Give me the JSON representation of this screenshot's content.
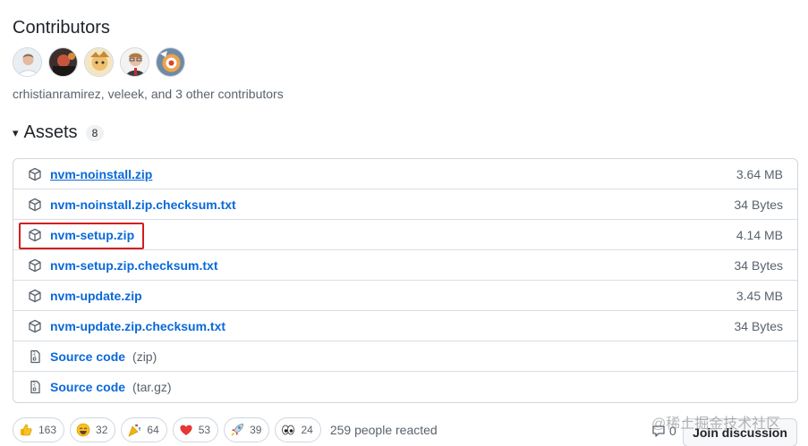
{
  "contributors": {
    "title": "Contributors",
    "summary": "crhistianramirez, veleek, and 3 other contributors"
  },
  "assets": {
    "caret": "▾",
    "title": "Assets",
    "count": "8",
    "items": [
      {
        "name": "nvm-noinstall.zip",
        "size": "3.64 MB"
      },
      {
        "name": "nvm-noinstall.zip.checksum.txt",
        "size": "34 Bytes"
      },
      {
        "name": "nvm-setup.zip",
        "size": "4.14 MB"
      },
      {
        "name": "nvm-setup.zip.checksum.txt",
        "size": "34 Bytes"
      },
      {
        "name": "nvm-update.zip",
        "size": "3.45 MB"
      },
      {
        "name": "nvm-update.zip.checksum.txt",
        "size": "34 Bytes"
      },
      {
        "name": "Source code",
        "sub": "(zip)"
      },
      {
        "name": "Source code",
        "sub": "(tar.gz)"
      }
    ]
  },
  "reactions": {
    "items": [
      {
        "icon": "thumbs-up-icon",
        "count": "163"
      },
      {
        "icon": "laugh-icon",
        "count": "32"
      },
      {
        "icon": "hooray-icon",
        "count": "64"
      },
      {
        "icon": "heart-icon",
        "count": "53"
      },
      {
        "icon": "rocket-icon",
        "count": "39"
      },
      {
        "icon": "eyes-icon",
        "count": "24"
      }
    ],
    "summary": "259 people reacted"
  },
  "discussion": {
    "comment_count": "0",
    "join_label": "Join discussion"
  },
  "watermark": "@稀土掘金技术社区"
}
